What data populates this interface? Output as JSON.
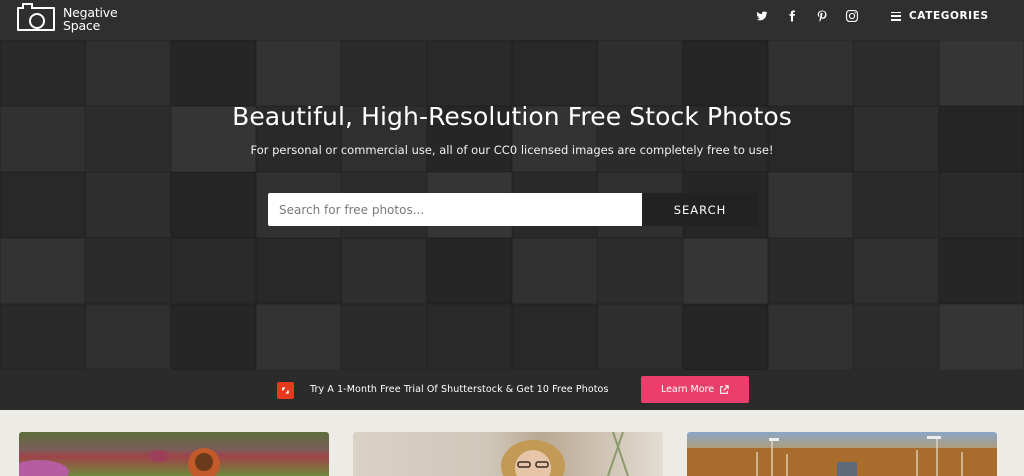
{
  "header": {
    "logo": {
      "line1": "Negative",
      "line2": "Space"
    },
    "socials": [
      {
        "icon": "twitter-icon"
      },
      {
        "icon": "facebook-icon"
      },
      {
        "icon": "pinterest-icon"
      },
      {
        "icon": "instagram-icon"
      }
    ],
    "categories_label": "CATEGORIES"
  },
  "hero": {
    "title": "Beautiful, High-Resolution Free Stock Photos",
    "subtitle": "For personal or commercial use, all of our CC0 licensed images are completely free to use!",
    "search": {
      "placeholder": "Search for free photos...",
      "value": "",
      "button_label": "SEARCH"
    }
  },
  "promo": {
    "icon": "shutterstock-icon",
    "text": "Try A 1-Month Free Trial Of Shutterstock & Get 10 Free Photos",
    "button_label": "Learn More",
    "button_icon": "external-link-icon",
    "button_color": "#e93f6a"
  },
  "colors": {
    "topbar": "#2f2f2f",
    "page_background": "#ecebe6",
    "search_button": "#222222"
  }
}
